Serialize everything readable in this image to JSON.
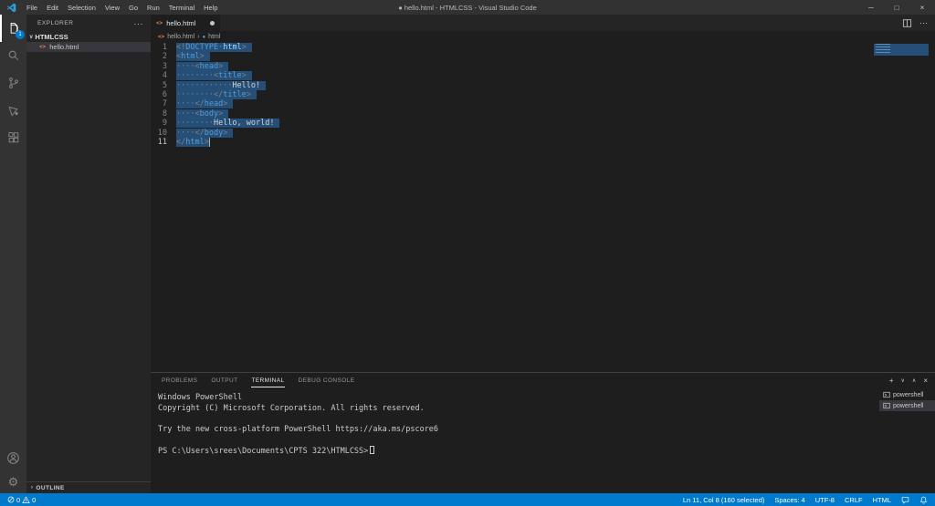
{
  "colors": {
    "accent": "#007acc",
    "selection": "#264f78",
    "statusbar": "#007acc",
    "editor_bg": "#1e1e1e",
    "sidebar_bg": "#252526",
    "activitybar_bg": "#333333",
    "titlebar_bg": "#323233",
    "tag_color": "#569cd6",
    "html_icon_color": "#e8824a"
  },
  "title_bar": {
    "title": "● hello.html - HTMLCSS - Visual Studio Code",
    "menus": [
      "File",
      "Edit",
      "Selection",
      "View",
      "Go",
      "Run",
      "Terminal",
      "Help"
    ],
    "controls": {
      "minimize": "─",
      "maximize": "□",
      "close": "×"
    }
  },
  "activity_bar": {
    "badge": "1",
    "gear_glyph": "⚙"
  },
  "sidebar": {
    "header": "EXPLORER",
    "header_more": "···",
    "folder_chevron": "∨",
    "folder": "HTMLCSS",
    "file_icon_glyph": "<>",
    "file": "hello.html",
    "outline_chevron": "›",
    "outline_label": "OUTLINE"
  },
  "editor": {
    "tab": {
      "icon_glyph": "<>",
      "label": "hello.html"
    },
    "tab_more": "···",
    "breadcrumb": {
      "file_icon_glyph": "<>",
      "file": "hello.html",
      "separator": "›",
      "symbol_icon_glyph": "●",
      "symbol": "html"
    },
    "code_lines": [
      {
        "num": "1",
        "tokens": [
          {
            "t": "<!",
            "c": "pun"
          },
          {
            "t": "DOCTYPE",
            "c": "tag"
          },
          {
            "t": "·",
            "c": "ws"
          },
          {
            "t": "html",
            "c": "attr"
          },
          {
            "t": ">",
            "c": "pun"
          }
        ]
      },
      {
        "num": "2",
        "tokens": [
          {
            "t": "<",
            "c": "pun"
          },
          {
            "t": "html",
            "c": "tag"
          },
          {
            "t": ">",
            "c": "pun"
          }
        ]
      },
      {
        "num": "3",
        "tokens": [
          {
            "t": "····",
            "c": "ws"
          },
          {
            "t": "<",
            "c": "pun"
          },
          {
            "t": "head",
            "c": "tag"
          },
          {
            "t": ">",
            "c": "pun"
          }
        ]
      },
      {
        "num": "4",
        "tokens": [
          {
            "t": "········",
            "c": "ws"
          },
          {
            "t": "<",
            "c": "pun"
          },
          {
            "t": "title",
            "c": "tag"
          },
          {
            "t": ">",
            "c": "pun"
          }
        ]
      },
      {
        "num": "5",
        "tokens": [
          {
            "t": "············",
            "c": "ws"
          },
          {
            "t": "Hello!",
            "c": "text"
          }
        ]
      },
      {
        "num": "6",
        "tokens": [
          {
            "t": "········",
            "c": "ws"
          },
          {
            "t": "</",
            "c": "pun"
          },
          {
            "t": "title",
            "c": "tag"
          },
          {
            "t": ">",
            "c": "pun"
          }
        ]
      },
      {
        "num": "7",
        "tokens": [
          {
            "t": "····",
            "c": "ws"
          },
          {
            "t": "</",
            "c": "pun"
          },
          {
            "t": "head",
            "c": "tag"
          },
          {
            "t": ">",
            "c": "pun"
          }
        ]
      },
      {
        "num": "8",
        "tokens": [
          {
            "t": "····",
            "c": "ws"
          },
          {
            "t": "<",
            "c": "pun"
          },
          {
            "t": "body",
            "c": "tag"
          },
          {
            "t": ">",
            "c": "pun"
          }
        ]
      },
      {
        "num": "9",
        "tokens": [
          {
            "t": "········",
            "c": "ws"
          },
          {
            "t": "Hello, world!",
            "c": "text"
          }
        ]
      },
      {
        "num": "10",
        "tokens": [
          {
            "t": "····",
            "c": "ws"
          },
          {
            "t": "</",
            "c": "pun"
          },
          {
            "t": "body",
            "c": "tag"
          },
          {
            "t": ">",
            "c": "pun"
          }
        ]
      },
      {
        "num": "11",
        "tokens": [
          {
            "t": "</",
            "c": "pun"
          },
          {
            "t": "html",
            "c": "tag"
          },
          {
            "t": ">",
            "c": "pun"
          }
        ]
      }
    ]
  },
  "panel": {
    "tabs": [
      "PROBLEMS",
      "OUTPUT",
      "TERMINAL",
      "DEBUG CONSOLE"
    ],
    "active_tab": "TERMINAL",
    "actions": {
      "new": "+",
      "dropdown": "∨",
      "maximize": "∧",
      "close": "×"
    },
    "terminal": {
      "lines": [
        "Windows PowerShell",
        "Copyright (C) Microsoft Corporation. All rights reserved.",
        "",
        "Try the new cross-platform PowerShell https://aka.ms/pscore6",
        ""
      ],
      "prompt": "PS C:\\Users\\srees\\Documents\\CPTS 322\\HTMLCSS>"
    },
    "terminal_list": [
      {
        "label": "powershell"
      },
      {
        "label": "powershell"
      }
    ]
  },
  "status_bar": {
    "errors": "0",
    "warnings": "0",
    "cursor": "Ln 11, Col 8 (160 selected)",
    "indent": "Spaces: 4",
    "encoding": "UTF-8",
    "eol": "CRLF",
    "language": "HTML"
  }
}
